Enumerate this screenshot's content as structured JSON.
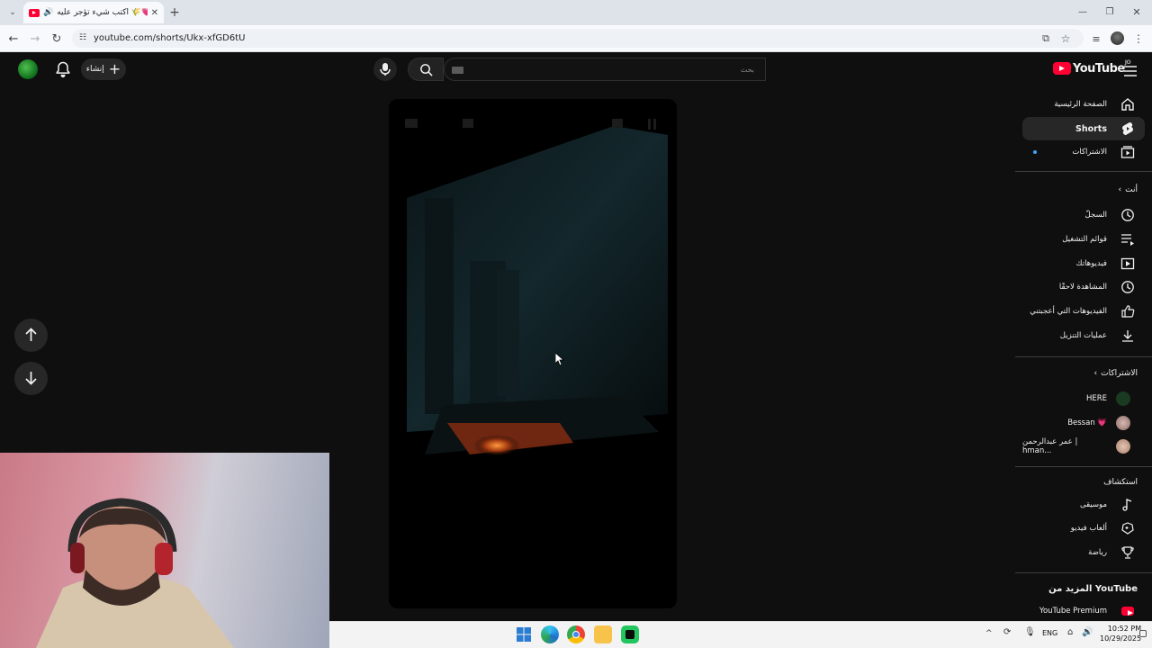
{
  "browser": {
    "tab_title": "اكتب شيء تؤجر عليه 🌾💗..",
    "url": "youtube.com/shorts/Ukx-xfGD6tU",
    "new_tab": "+"
  },
  "header": {
    "logo_text": "YouTube",
    "logo_badge": "JO",
    "search_placeholder": "بحث",
    "create_label": "إنشاء"
  },
  "sidebar": {
    "top_items": [
      {
        "label": "الصفحة الرئيسية",
        "icon": "home-icon"
      },
      {
        "label": "Shorts",
        "icon": "shorts-icon",
        "active": true
      },
      {
        "label": "الاشتراكات",
        "icon": "subscriptions-icon"
      }
    ],
    "you_heading": "أنت",
    "you_items": [
      {
        "label": "السجلّ",
        "icon": "history-icon"
      },
      {
        "label": "قوائم التشغيل",
        "icon": "playlist-icon"
      },
      {
        "label": "فيديوهاتك",
        "icon": "your-videos-icon"
      },
      {
        "label": "المشاهدة لاحقًا",
        "icon": "watch-later-icon"
      },
      {
        "label": "الفيديوهات التي أعجبتني",
        "icon": "liked-icon"
      },
      {
        "label": "عمليات التنزيل",
        "icon": "download-icon"
      }
    ],
    "subs_heading": "الاشتراكات",
    "subscriptions": [
      {
        "label": "HERE"
      },
      {
        "label": "Bessan 💗"
      },
      {
        "label": "عمر عبدالرحمن | hman..."
      }
    ],
    "explore_heading": "استكشاف",
    "explore_items": [
      {
        "label": "موسيقى",
        "icon": "music-icon"
      },
      {
        "label": "ألعاب فيديو",
        "icon": "gaming-icon"
      },
      {
        "label": "رياضة",
        "icon": "trophy-icon"
      }
    ],
    "more_heading": "المزيد من YouTube",
    "more_items": [
      {
        "label": "YouTube Premium",
        "icon": "youtube-premium-icon"
      }
    ]
  },
  "taskbar": {
    "lang": "ENG",
    "time": "10:52 PM",
    "date": "10/29/2025"
  },
  "colors": {
    "brand_red": "#ff0033",
    "bg": "#0f0f0f",
    "active_item": "#272727"
  }
}
